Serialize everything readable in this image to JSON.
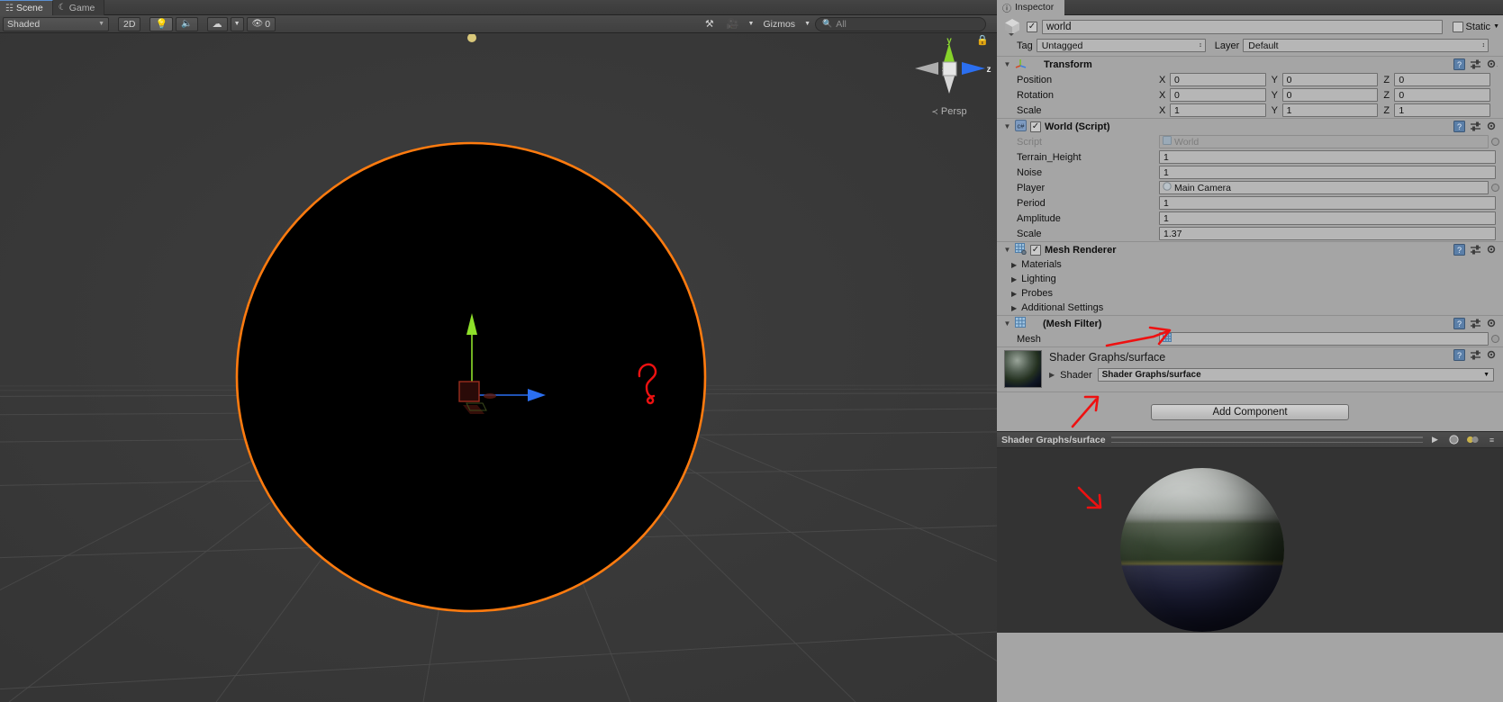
{
  "scene_view": {
    "tabs": [
      {
        "label": "Scene",
        "icon": "grid-icon",
        "active": true
      },
      {
        "label": "Game",
        "icon": "gamepad-icon",
        "active": false
      }
    ],
    "toolbar": {
      "draw_mode": "Shaded",
      "dimension_toggle": "2D",
      "lighting_icon": "lightbulb-icon",
      "audio_icon": "speaker-icon",
      "fx_icon": "fx-icon",
      "hidden_count": "0",
      "hidden_icon": "eye-slash-icon",
      "tools_icon": "tools-icon",
      "camera_icon": "camera-icon",
      "gizmos_label": "Gizmos",
      "search_placeholder": "All",
      "search_value": "All",
      "search_icon": "search-icon"
    },
    "gizmo": {
      "y_label": "y",
      "z_label": "z",
      "projection": "Persp",
      "lock_icon": "lock-icon"
    },
    "annotation": "red-squiggle-annotation"
  },
  "inspector": {
    "tab": {
      "label": "Inspector",
      "icon": "info-icon"
    },
    "menu_icon": "panel-menu-icon",
    "object": {
      "icon": "cube-icon",
      "enabled": true,
      "name": "world",
      "static_label": "Static",
      "static_checked": false,
      "tag_label": "Tag",
      "tag_value": "Untagged",
      "layer_label": "Layer",
      "layer_value": "Default"
    },
    "components": [
      {
        "id": "transform",
        "title": "Transform",
        "icon": "transform-icon",
        "expanded": true,
        "has_checkbox": false,
        "help_icon": "help-icon",
        "preset_icon": "preset-icon",
        "settings_icon": "gear-icon",
        "vectors": [
          {
            "name": "Position",
            "x": "0",
            "y": "0",
            "z": "0"
          },
          {
            "name": "Rotation",
            "x": "0",
            "y": "0",
            "z": "0"
          },
          {
            "name": "Scale",
            "x": "1",
            "y": "1",
            "z": "1"
          }
        ]
      },
      {
        "id": "world-script",
        "title": "World (Script)",
        "icon": "csharp-icon",
        "expanded": true,
        "has_checkbox": true,
        "checked": true,
        "help_icon": "help-icon",
        "preset_icon": "preset-icon",
        "settings_icon": "gear-icon",
        "props": [
          {
            "name": "Script",
            "value": "World",
            "type": "object",
            "disabled": true,
            "icon": "script-icon"
          },
          {
            "name": "Terrain_Height",
            "value": "1",
            "type": "text"
          },
          {
            "name": "Noise",
            "value": "1",
            "type": "text"
          },
          {
            "name": "Player",
            "value": "Main Camera",
            "type": "object",
            "icon": "camera-obj-icon"
          },
          {
            "name": "Period",
            "value": "1",
            "type": "text"
          },
          {
            "name": "Amplitude",
            "value": "1",
            "type": "text"
          },
          {
            "name": "Scale",
            "value": "1.37",
            "type": "text"
          }
        ]
      },
      {
        "id": "mesh-renderer",
        "title": "Mesh Renderer",
        "icon": "mesh-renderer-icon",
        "expanded": true,
        "has_checkbox": true,
        "checked": true,
        "help_icon": "help-icon",
        "preset_icon": "preset-icon",
        "settings_icon": "gear-icon",
        "foldouts": [
          "Materials",
          "Lighting",
          "Probes",
          "Additional Settings"
        ]
      },
      {
        "id": "mesh-filter",
        "title": "(Mesh Filter)",
        "icon": "mesh-filter-icon",
        "expanded": true,
        "has_checkbox": false,
        "help_icon": "help-icon",
        "preset_icon": "preset-icon",
        "settings_icon": "gear-icon",
        "props": [
          {
            "name": "Mesh",
            "value": "",
            "type": "object",
            "icon": "mesh-icon"
          }
        ]
      }
    ],
    "material": {
      "name": "Shader Graphs/surface",
      "shader_label": "Shader",
      "shader_value": "Shader Graphs/surface",
      "help_icon": "help-icon",
      "preset_icon": "preset-icon",
      "settings_icon": "gear-icon"
    },
    "add_component_label": "Add Component",
    "preview": {
      "title": "Shader Graphs/surface",
      "play_icon": "play-icon",
      "sphere_icon": "sphere-icon",
      "lighting_icon": "lighting-toggle-icon",
      "menu_icon": "preview-menu-icon"
    },
    "annotations": [
      {
        "id": "mesh-field-arrow",
        "target": "mesh-object-field"
      },
      {
        "id": "add-component-arrow",
        "target": "add-component-button"
      },
      {
        "id": "preview-sphere-arrow",
        "target": "preview-sphere"
      }
    ]
  }
}
